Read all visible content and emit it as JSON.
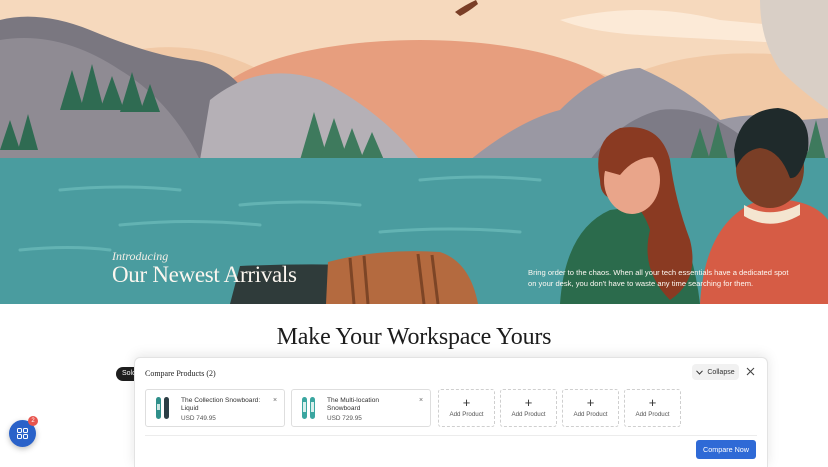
{
  "hero": {
    "kicker": "Introducing",
    "title": "Our Newest Arrivals",
    "description": "Bring order to the chaos. When all your tech essentials have a dedicated spot on your desk, you don't have to waste any time searching for them."
  },
  "section": {
    "title": "Make Your Workspace Yours",
    "badge": "Sold"
  },
  "compare_bar": {
    "title": "Compare Products (2)",
    "collapse_label": "Collapse",
    "close_icon": "close-icon",
    "products": [
      {
        "name": "The Collection Snowboard: Liquid",
        "price": "USD 749.95",
        "remove": "×",
        "color": "#2f8f8a"
      },
      {
        "name": "The Multi-location Snowboard",
        "price": "USD 729.95",
        "remove": "×",
        "color": "#3aa6a0"
      }
    ],
    "slots": [
      {
        "plus": "+",
        "label": "Add Product"
      },
      {
        "plus": "+",
        "label": "Add Product"
      },
      {
        "plus": "+",
        "label": "Add Product"
      },
      {
        "plus": "+",
        "label": "Add Product"
      }
    ],
    "compare_now_label": "Compare Now"
  },
  "floating_button": {
    "icon": "grid-icon",
    "badge": "2"
  },
  "colors": {
    "accent": "#2f6ad6",
    "badge": "#e8554e",
    "sky": "#f1c9a6",
    "lake": "#4a9c9f"
  }
}
